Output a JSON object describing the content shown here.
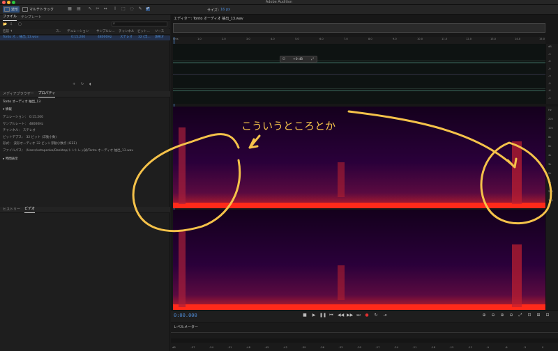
{
  "window": {
    "title": "Adobe Audition"
  },
  "toolbar": {
    "waveform_label": "波形",
    "multitrack_label": "マルチトラック",
    "size_label": "サイズ：",
    "size_value": "16 px"
  },
  "files_panel": {
    "tabs": [
      "ファイル",
      "テンプレート"
    ],
    "columns": [
      "名前 ↑",
      "ス..",
      "デュレーション",
      "サンプルレ...",
      "チャンネル",
      "ビット...",
      "ソース"
    ],
    "file_row": {
      "name": "Tonto オ... 抽出_13.wav",
      "duration": "0:15.200",
      "sample_rate": "48000Hz",
      "channel": "ステレオ",
      "bit": "32 (浮...",
      "source": "波形オ"
    }
  },
  "props_panel": {
    "tabs": [
      "メディアブラウザー",
      "プロパティ"
    ],
    "file_title": "Tonto オーディオ 抽出_13",
    "info_section": "情報",
    "info_rows": [
      {
        "key": "デュレーション：",
        "val": "0:15.200"
      },
      {
        "key": "サンプルレート：",
        "val": "48000Hz"
      },
      {
        "key": "チャンネル：",
        "val": "ステレオ"
      },
      {
        "key": "ビットデプス：",
        "val": "32 ビット (浮動小数)"
      },
      {
        "key": "形式：",
        "val": "波形オーディオ 32 ビット浮動小数点 (IEEE)"
      },
      {
        "key": "ファイルパス：",
        "val": "/Users/ostapenko/Desktop/トントレッ試/Tonto オーディオ 抽出_13.wav"
      }
    ],
    "time_section": "時間表示"
  },
  "history_panel": {
    "tabs": [
      "ヒストリー",
      "ビデオ"
    ]
  },
  "editor": {
    "title": "エディター: Tonto オーディオ 抽出_13.wav",
    "timeline_ticks": [
      "hms",
      "1.0",
      "2.0",
      "3.0",
      "4.0",
      "5.0",
      "6.0",
      "7.0",
      "8.0",
      "9.0",
      "10.0",
      "11.0",
      "12.0",
      "13.0",
      "14.0",
      "15.0"
    ],
    "hud_value": "+0 dB",
    "waveform_db_ticks": [
      "dB",
      "-3",
      "-6",
      "-9",
      "-∞",
      "-9",
      "-6",
      "-3"
    ],
    "spec_hz_ticks": [
      "Hz",
      "20k",
      "10k",
      "8k",
      "6k",
      "4k",
      "3k",
      "2k",
      "1k",
      "500",
      "100"
    ],
    "current_time": "0:00.000"
  },
  "level_meter": {
    "title": "レベルメーター",
    "ticks": [
      "dB",
      "-57",
      "-54",
      "-51",
      "-48",
      "-45",
      "-42",
      "-39",
      "-36",
      "-33",
      "-30",
      "-27",
      "-24",
      "-21",
      "-18",
      "-15",
      "-12",
      "-9",
      "-6",
      "-3",
      "0"
    ]
  },
  "annotation": {
    "text": "こういうところとか",
    "color": "#f5c24a"
  },
  "colors": {
    "accent": "#4f8ed9",
    "spectrogram_bg": "#14001c",
    "red": "#ff2a1a"
  }
}
